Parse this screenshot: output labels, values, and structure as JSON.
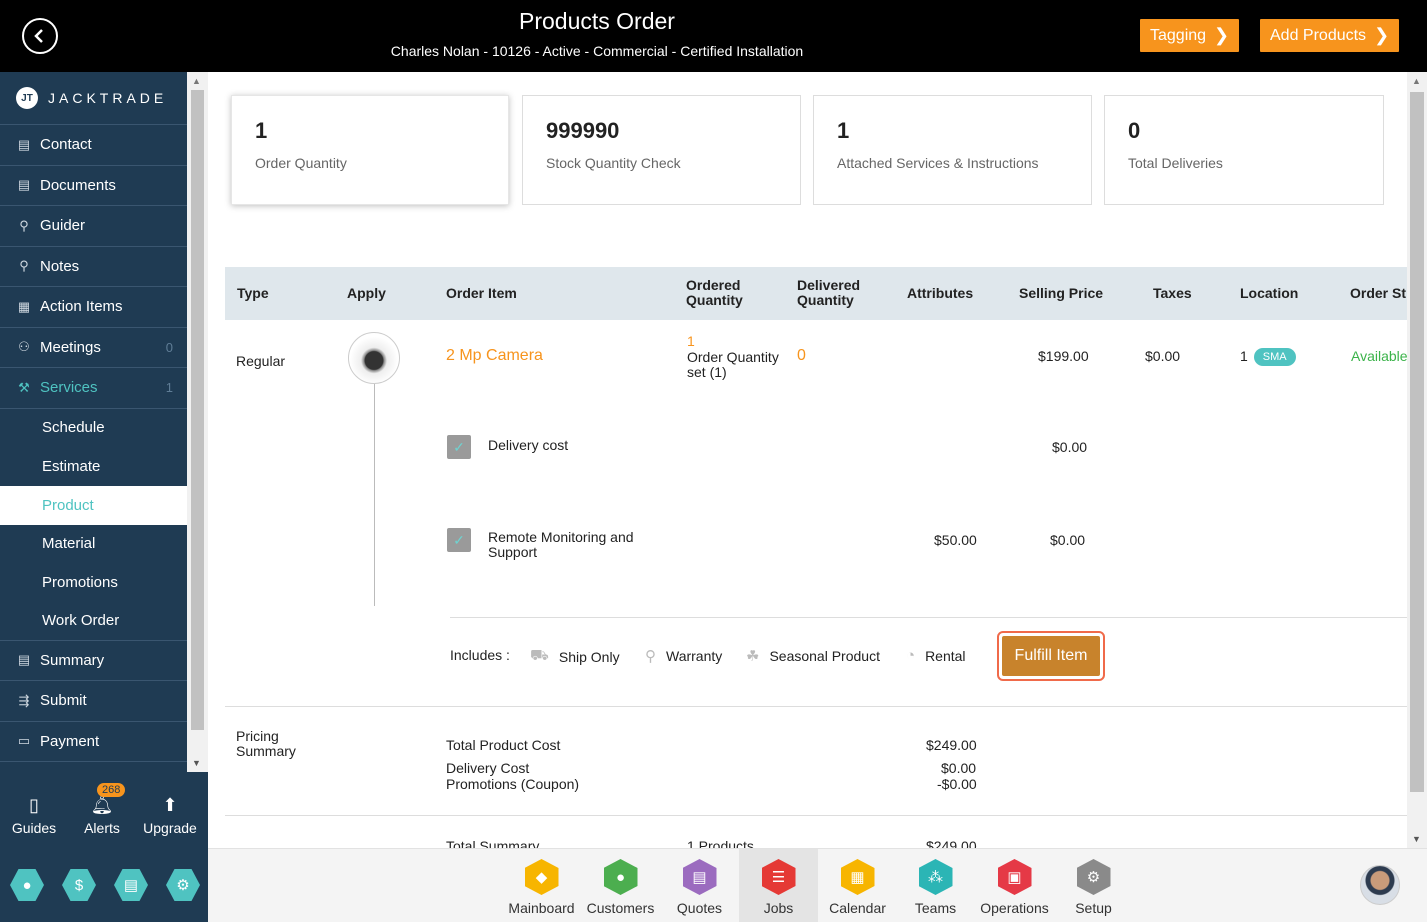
{
  "header": {
    "title": "Products Order",
    "subtitle": "Charles Nolan - 10126 - Active - Commercial - Certified Installation",
    "tagging_label": "Tagging",
    "add_products_label": "Add Products"
  },
  "sidebar": {
    "brand": "JACKTRADE",
    "brand_badge": "JT",
    "items": [
      {
        "label": "Contact",
        "icon": "contact-icon"
      },
      {
        "label": "Documents",
        "icon": "documents-icon"
      },
      {
        "label": "Guider",
        "icon": "guider-icon"
      },
      {
        "label": "Notes",
        "icon": "notes-icon"
      },
      {
        "label": "Action Items",
        "icon": "action-items-icon"
      },
      {
        "label": "Meetings",
        "icon": "meetings-icon",
        "count": "0"
      },
      {
        "label": "Services",
        "icon": "services-icon",
        "count": "1"
      }
    ],
    "subitems": [
      "Schedule",
      "Estimate",
      "Product",
      "Material",
      "Promotions",
      "Work Order"
    ],
    "active_subitem": "Product",
    "items_after": [
      {
        "label": "Summary",
        "icon": "summary-icon"
      },
      {
        "label": "Submit",
        "icon": "submit-icon"
      },
      {
        "label": "Payment",
        "icon": "payment-icon"
      }
    ],
    "bottom": {
      "guides": "Guides",
      "alerts": "Alerts",
      "alerts_count": "268",
      "upgrade": "Upgrade"
    }
  },
  "summary_cards": [
    {
      "value": "1",
      "label": "Order Quantity"
    },
    {
      "value": "999990",
      "label": "Stock Quantity Check"
    },
    {
      "value": "1",
      "label": "Attached Services & Instructions"
    },
    {
      "value": "0",
      "label": "Total Deliveries"
    }
  ],
  "table": {
    "headers": {
      "type": "Type",
      "apply": "Apply",
      "order_item": "Order Item",
      "ordered_qty_1": "Ordered",
      "ordered_qty_2": "Quantity",
      "delivered_qty_1": "Delivered",
      "delivered_qty_2": "Quantity",
      "attributes": "Attributes",
      "selling_price": "Selling Price",
      "taxes": "Taxes",
      "location": "Location",
      "order_status": "Order St"
    },
    "row": {
      "type": "Regular",
      "item_name": "2 Mp Camera",
      "ordered_qty": "1",
      "ordered_qty_note_1": "Order Quantity",
      "ordered_qty_note_2": "set (1)",
      "delivered_qty": "0",
      "selling_price": "$199.00",
      "taxes": "$0.00",
      "location_qty": "1",
      "location_badge": "SMA",
      "status": "Available"
    },
    "services": [
      {
        "label": "Delivery cost",
        "attribute": "",
        "price": "$0.00"
      },
      {
        "label_1": "Remote Monitoring and",
        "label_2": "Support",
        "attribute": "$50.00",
        "price": "$0.00"
      }
    ],
    "includes_label": "Includes :",
    "includes": [
      {
        "label": "Ship Only",
        "icon": "truck-icon"
      },
      {
        "label": "Warranty",
        "icon": "warranty-icon"
      },
      {
        "label": "Seasonal Product",
        "icon": "seasonal-icon"
      },
      {
        "label": "Rental",
        "icon": "rental-icon"
      }
    ],
    "fulfill_label": "Fulfill Item"
  },
  "pricing": {
    "title_1": "Pricing",
    "title_2": "Summary",
    "total_product_cost_label": "Total Product Cost",
    "total_product_cost": "$249.00",
    "delivery_cost_label": "Delivery Cost",
    "delivery_cost": "$0.00",
    "promotions_label": "Promotions (Coupon)",
    "promotions": "-$0.00",
    "total_summary_label": "Total Summary",
    "total_products": "1 Products",
    "total_summary": "$249.00"
  },
  "bottom_nav": [
    {
      "label": "Mainboard",
      "icon": "mainboard-icon",
      "color": "#f7b500"
    },
    {
      "label": "Customers",
      "icon": "customers-icon",
      "color": "#4cae4f"
    },
    {
      "label": "Quotes",
      "icon": "quotes-icon",
      "color": "#9b6bbf"
    },
    {
      "label": "Jobs",
      "icon": "jobs-icon",
      "color": "#e53935"
    },
    {
      "label": "Calendar",
      "icon": "calendar-icon",
      "color": "#f7b500"
    },
    {
      "label": "Teams",
      "icon": "teams-icon",
      "color": "#2bb5b5"
    },
    {
      "label": "Operations",
      "icon": "operations-icon",
      "color": "#e53946"
    },
    {
      "label": "Setup",
      "icon": "setup-icon",
      "color": "#8a8a8a"
    }
  ],
  "active_nav": "Jobs"
}
